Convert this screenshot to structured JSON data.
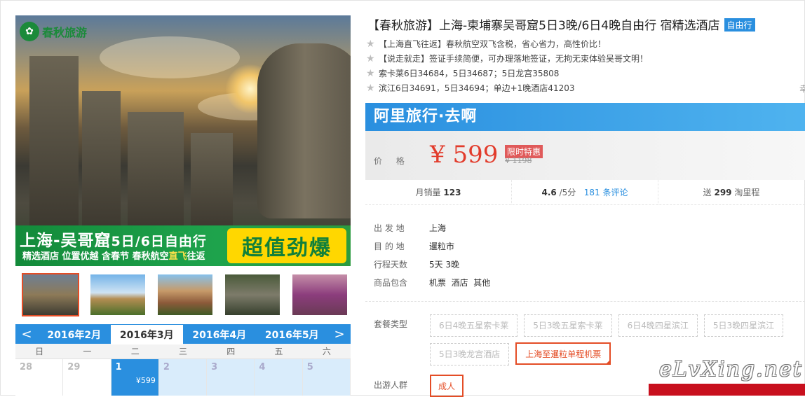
{
  "hero": {
    "logo_text": "春秋旅游",
    "banner_title_a": "上海-吴哥窟",
    "banner_title_b": "5日/6日自由行",
    "banner_sub_a": "精选酒店 位置优越 含春节 春秋航空",
    "banner_sub_b": "直飞",
    "banner_sub_c": "往返",
    "banner_badge": "超值劲爆"
  },
  "thumbnails": [
    {
      "name": "thumb-1",
      "active": true
    },
    {
      "name": "thumb-2",
      "active": false
    },
    {
      "name": "thumb-3",
      "active": false
    },
    {
      "name": "thumb-4",
      "active": false
    },
    {
      "name": "thumb-5",
      "active": false
    }
  ],
  "calendar": {
    "prev": "<",
    "next": ">",
    "months": [
      "2016年2月",
      "2016年3月",
      "2016年4月",
      "2016年5月"
    ],
    "active_month_index": 1,
    "weekdays": [
      "日",
      "一",
      "二",
      "三",
      "四",
      "五",
      "六"
    ],
    "days": [
      {
        "d": "28",
        "state": "off",
        "price": ""
      },
      {
        "d": "29",
        "state": "off",
        "price": ""
      },
      {
        "d": "1",
        "state": "sel",
        "price": "¥599"
      },
      {
        "d": "2",
        "state": "avail",
        "price": ""
      },
      {
        "d": "3",
        "state": "avail",
        "price": ""
      },
      {
        "d": "4",
        "state": "avail",
        "price": ""
      },
      {
        "d": "5",
        "state": "avail",
        "price": ""
      }
    ]
  },
  "product": {
    "title": "【春秋旅游】上海-柬埔寨吴哥窟5日3晚/6日4晚自由行 宿精选酒店",
    "type_tag": "自由行",
    "features": [
      "【上海直飞往返】春秋航空双飞含税，省心省力，高性价比！",
      "【说走就走】签证手续简便，可办理落地签证，无拘无束体验吴哥文明！",
      "索卡莱6日34684，5日34687；5日龙宫35808",
      "滨江6日34691，5日34694；单边+1晚酒店41203"
    ],
    "more_cut": "幸"
  },
  "brand": {
    "name": "阿里旅行·去啊"
  },
  "price": {
    "label": "价 格",
    "current": "¥ 599",
    "badge": "限时特惠",
    "original": "¥ 1198"
  },
  "stats": {
    "monthly_label": "月销量",
    "monthly_value": "123",
    "rating_value": "4.6",
    "rating_unit": "/5分",
    "reviews_count": "181",
    "reviews_label": "条评论",
    "points_label_a": "送",
    "points_value": "299",
    "points_label_b": "淘里程"
  },
  "info": [
    {
      "k": "出 发 地",
      "v": "上海"
    },
    {
      "k": "目 的 地",
      "v": "暹粒市"
    },
    {
      "k": "行程天数",
      "v": "5天 3晚"
    },
    {
      "k": "商品包含",
      "v": "机票  酒店  其他"
    }
  ],
  "packages": {
    "label": "套餐类型",
    "options": [
      {
        "t": "6日4晚五星索卡莱",
        "sel": false
      },
      {
        "t": "5日3晚五星索卡莱",
        "sel": false
      },
      {
        "t": "6日4晚四星滨江",
        "sel": false
      },
      {
        "t": "5日3晚四星滨江",
        "sel": false
      },
      {
        "t": "5日3晚龙宫酒店",
        "sel": false
      },
      {
        "t": "上海至暹粒单程机票",
        "sel": true
      }
    ]
  },
  "crowd": {
    "label": "出游人群",
    "option": "成人"
  },
  "watermark": "eLvXing.net",
  "colors": {
    "accent": "#2a8fdf",
    "price": "#e23b2b",
    "selected": "#e44d26"
  }
}
